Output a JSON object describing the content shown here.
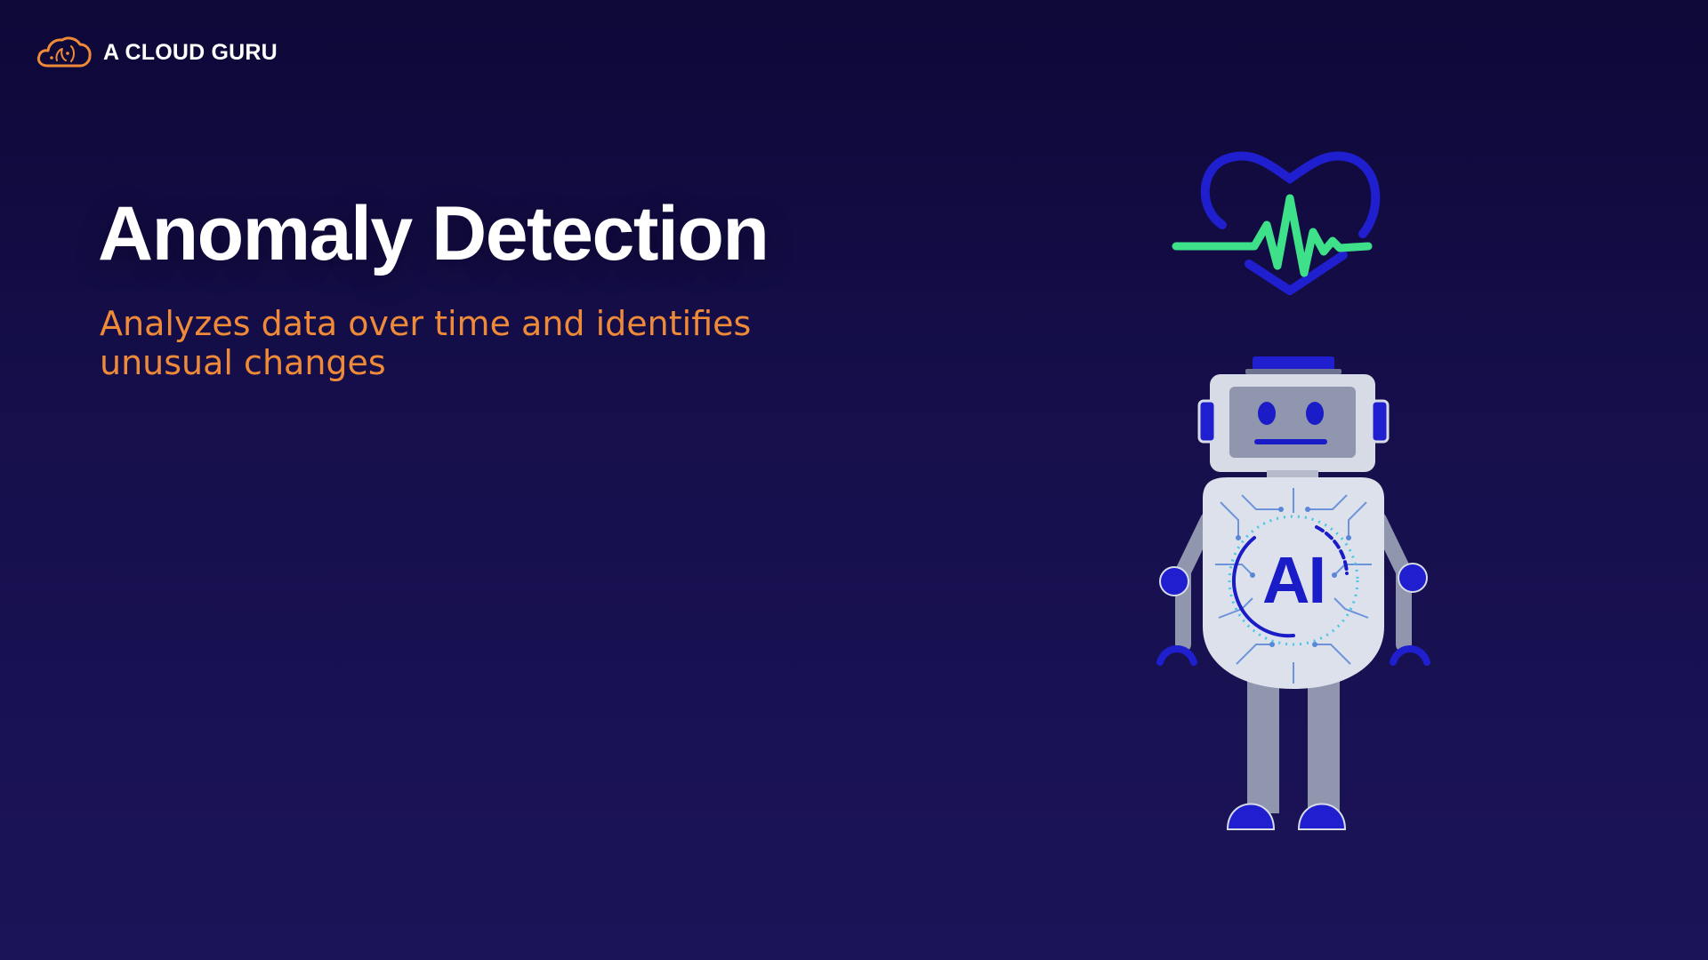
{
  "brand": {
    "name": "A CLOUD GURU",
    "logo_icon": "cloud-logo-icon",
    "logo_color": "#ef8a38"
  },
  "slide": {
    "title": "Anomaly Detection",
    "subtitle": "Analyzes data over time and identifies unusual changes"
  },
  "illustration": {
    "heart_icon": "heartbeat-heart-icon",
    "robot_icon": "ai-robot-icon",
    "chest_label": "AI",
    "heart_color": "#1f1fd0",
    "pulse_color": "#3ee08a",
    "robot_body_color": "#d7dbe6",
    "robot_accent_color": "#1a1cc8"
  },
  "colors": {
    "background_top": "#0e0838",
    "background_bottom": "#1b1458",
    "title": "#ffffff",
    "subtitle": "#ef8a38"
  }
}
